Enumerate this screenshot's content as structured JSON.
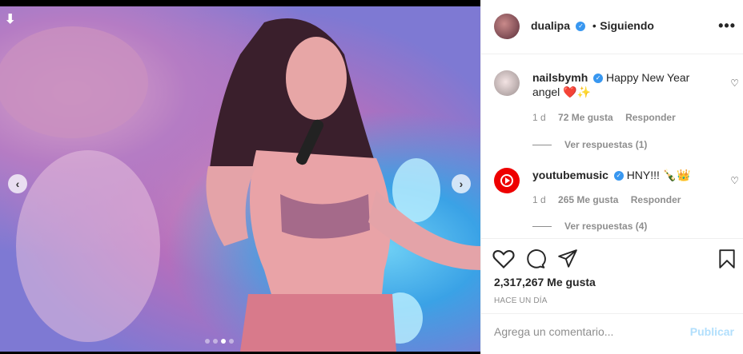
{
  "post": {
    "username": "dualipa",
    "follow_status": "Siguiendo",
    "separator": "•"
  },
  "comments": [
    {
      "username": "nailsbymh",
      "text": "Happy New Year angel",
      "emoji": "❤️✨",
      "age": "1 d",
      "likes": "72 Me gusta",
      "reply": "Responder",
      "view_replies": "Ver respuestas (1)"
    },
    {
      "username": "youtubemusic",
      "text": "HNY!!!",
      "emoji": "🍾👑",
      "age": "1 d",
      "likes": "265 Me gusta",
      "reply": "Responder",
      "view_replies": "Ver respuestas (4)"
    }
  ],
  "stats": {
    "likes": "2,317,267 Me gusta",
    "time_ago": "HACE UN DÍA"
  },
  "composer": {
    "placeholder": "Agrega un comentario...",
    "post_label": "Publicar"
  },
  "carousel": {
    "slide_count": 4,
    "active_index": 2
  },
  "icons": [
    "download-arrow-icon",
    "prev-arrow-icon",
    "next-arrow-icon",
    "verified-icon",
    "more-options-icon",
    "heart-icon",
    "comment-icon",
    "share-icon",
    "bookmark-icon"
  ],
  "colors": {
    "verified": "#3897f0",
    "publish_disabled": "#b2dffc",
    "muted": "#8e8e8e"
  }
}
